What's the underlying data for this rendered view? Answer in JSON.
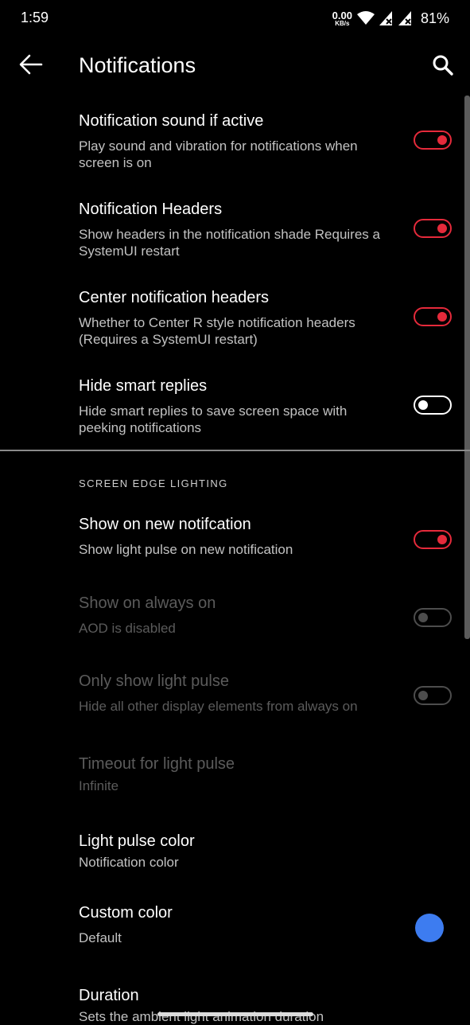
{
  "status_bar": {
    "time": "1:59",
    "net_speed_value": "0.00",
    "net_speed_unit": "KB/s",
    "battery": "81%"
  },
  "header": {
    "title": "Notifications",
    "back_icon": "arrow-left-icon",
    "search_icon": "search-icon"
  },
  "colors": {
    "accent": "#e52a3b",
    "custom_color": "#3d7cf0"
  },
  "settings": [
    {
      "title": "Notification sound if active",
      "subtitle": "Play sound and vibration for notifications when screen is on",
      "state": "on"
    },
    {
      "title": "Notification Headers",
      "subtitle": "Show headers in the notification shade Requires a SystemUI restart",
      "state": "on"
    },
    {
      "title": "Center notification headers",
      "subtitle": "Whether to Center R style notification headers (Requires a SystemUI restart)",
      "state": "on"
    },
    {
      "title": "Hide smart replies",
      "subtitle": "Hide smart replies to save screen space with peeking notifications",
      "state": "off"
    }
  ],
  "section": {
    "header": "SCREEN EDGE LIGHTING"
  },
  "edge_settings": [
    {
      "title": "Show on new notifcation",
      "subtitle": "Show light pulse on new notification",
      "state": "on"
    },
    {
      "title": "Show on always on",
      "subtitle": "AOD is disabled",
      "state": "disabled"
    },
    {
      "title": "Only show light pulse",
      "subtitle": "Hide all other display elements from always on",
      "state": "disabled"
    },
    {
      "title": "Timeout for light pulse",
      "subtitle": "Infinite",
      "state": "disabled"
    },
    {
      "title": "Light pulse color",
      "subtitle": "Notification color"
    },
    {
      "title": "Custom color",
      "subtitle": "Default"
    },
    {
      "title": "Duration",
      "subtitle": "Sets the ambient light animation duration"
    }
  ]
}
